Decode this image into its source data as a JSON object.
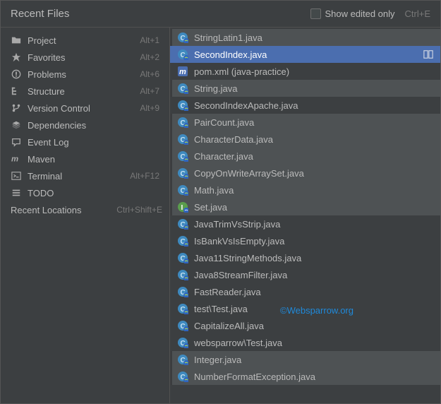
{
  "header": {
    "title": "Recent Files",
    "checkbox_label": "Show edited only",
    "checkbox_shortcut": "Ctrl+E"
  },
  "sidebar": {
    "items": [
      {
        "icon": "folder-icon",
        "label": "Project",
        "shortcut": "Alt+1"
      },
      {
        "icon": "star-icon",
        "label": "Favorites",
        "shortcut": "Alt+2"
      },
      {
        "icon": "warning-icon",
        "label": "Problems",
        "shortcut": "Alt+6"
      },
      {
        "icon": "structure-icon",
        "label": "Structure",
        "shortcut": "Alt+7"
      },
      {
        "icon": "branch-icon",
        "label": "Version Control",
        "shortcut": "Alt+9"
      },
      {
        "icon": "layers-icon",
        "label": "Dependencies",
        "shortcut": ""
      },
      {
        "icon": "message-icon",
        "label": "Event Log",
        "shortcut": ""
      },
      {
        "icon": "maven-icon",
        "label": "Maven",
        "shortcut": ""
      },
      {
        "icon": "terminal-icon",
        "label": "Terminal",
        "shortcut": "Alt+F12"
      },
      {
        "icon": "list-icon",
        "label": "TODO",
        "shortcut": ""
      }
    ],
    "section_label": "Recent Locations",
    "section_shortcut": "Ctrl+Shift+E"
  },
  "files": [
    {
      "icon": "class",
      "label": "StringLatin1.java",
      "hl": true,
      "selected": false
    },
    {
      "icon": "class",
      "label": "SecondIndex.java",
      "hl": false,
      "selected": true,
      "trail": true
    },
    {
      "icon": "maven",
      "label": "pom.xml (java-practice)",
      "hl": false,
      "selected": false
    },
    {
      "icon": "class",
      "label": "String.java",
      "hl": true,
      "selected": false
    },
    {
      "icon": "class",
      "label": "SecondIndexApache.java",
      "hl": false,
      "selected": false
    },
    {
      "icon": "class",
      "label": "PairCount.java",
      "hl": true,
      "selected": false
    },
    {
      "icon": "class",
      "label": "CharacterData.java",
      "hl": true,
      "selected": false
    },
    {
      "icon": "class",
      "label": "Character.java",
      "hl": true,
      "selected": false
    },
    {
      "icon": "class",
      "label": "CopyOnWriteArraySet.java",
      "hl": true,
      "selected": false
    },
    {
      "icon": "class",
      "label": "Math.java",
      "hl": true,
      "selected": false
    },
    {
      "icon": "interface",
      "label": "Set.java",
      "hl": true,
      "selected": false
    },
    {
      "icon": "class",
      "label": "JavaTrimVsStrip.java",
      "hl": false,
      "selected": false
    },
    {
      "icon": "class",
      "label": "IsBankVsIsEmpty.java",
      "hl": false,
      "selected": false
    },
    {
      "icon": "class",
      "label": "Java11StringMethods.java",
      "hl": false,
      "selected": false
    },
    {
      "icon": "class",
      "label": "Java8StreamFilter.java",
      "hl": false,
      "selected": false
    },
    {
      "icon": "class",
      "label": "FastReader.java",
      "hl": false,
      "selected": false
    },
    {
      "icon": "class",
      "label": "test\\Test.java",
      "hl": false,
      "selected": false
    },
    {
      "icon": "class",
      "label": "CapitalizeAll.java",
      "hl": false,
      "selected": false
    },
    {
      "icon": "class",
      "label": "websparrow\\Test.java",
      "hl": false,
      "selected": false
    },
    {
      "icon": "class",
      "label": "Integer.java",
      "hl": true,
      "selected": false
    },
    {
      "icon": "class",
      "label": "NumberFormatException.java",
      "hl": true,
      "selected": false
    }
  ],
  "watermark": "©Websparrow.org"
}
